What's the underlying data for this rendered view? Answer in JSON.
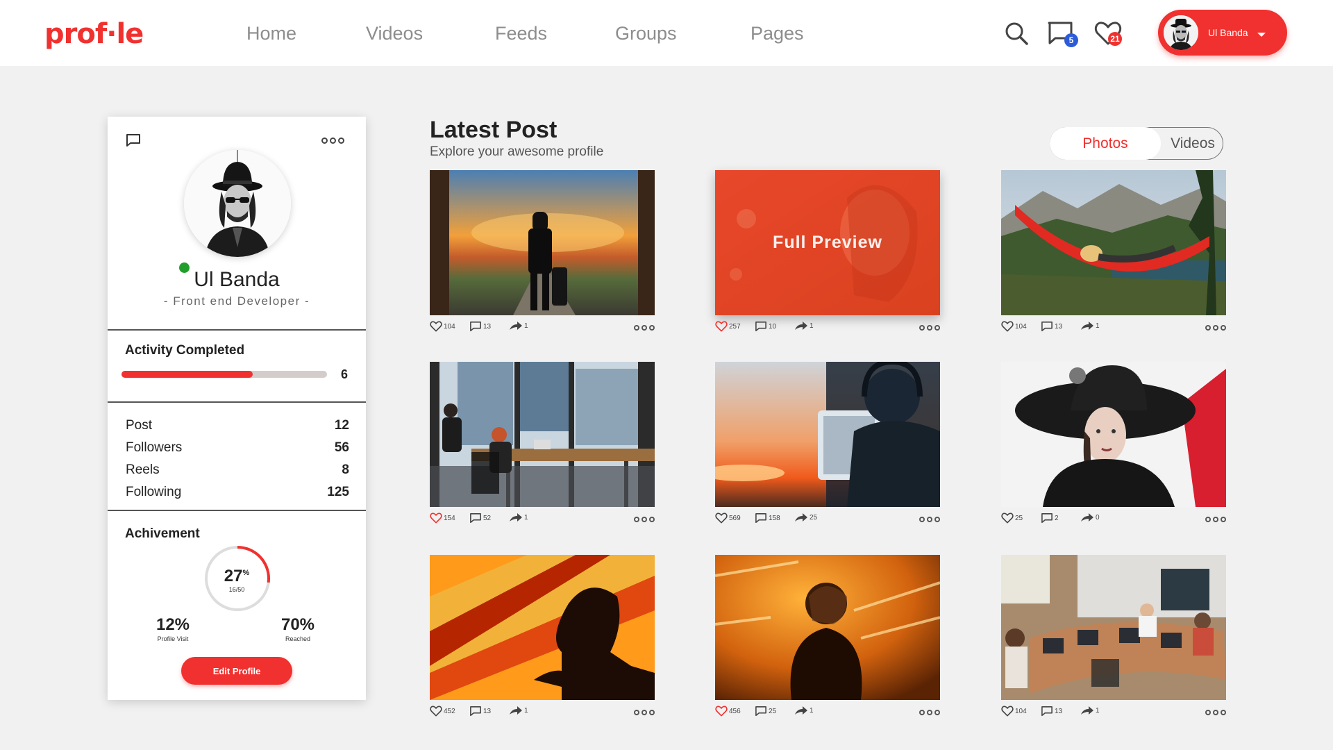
{
  "header": {
    "logo": "prof·le",
    "nav": [
      "Home",
      "Videos",
      "Feeds",
      "Groups",
      "Pages"
    ],
    "messages_badge": "5",
    "likes_badge": "21",
    "user_name": "Ul Banda",
    "accent": "#f0312f"
  },
  "profile": {
    "name": "Ul Banda",
    "role": "- Front end Developer -",
    "status": "online",
    "activity_title": "Activity Completed",
    "activity_value": "6",
    "activity_progress": 0.64,
    "stats": [
      {
        "label": "Post",
        "value": "12"
      },
      {
        "label": "Followers",
        "value": "56"
      },
      {
        "label": "Reels",
        "value": "8"
      },
      {
        "label": "Following",
        "value": "125"
      }
    ],
    "achievement_title": "Achivement",
    "achievement_pct": "27",
    "achievement_pct_symbol": "%",
    "achievement_fraction": "16/50",
    "achievement_progress": 0.27,
    "profile_visit_value": "12%",
    "profile_visit_label": "Profile Visit",
    "reached_value": "70%",
    "reached_label": "Reached",
    "edit_button": "Edit Profile"
  },
  "main": {
    "title": "Latest Post",
    "subtitle": "Explore your awesome profile",
    "toggle": {
      "active": "Photos",
      "inactive": "Videos"
    },
    "full_preview_label": "Full Preview",
    "posts": [
      {
        "likes": "104",
        "comments": "13",
        "shares": "1",
        "liked": false,
        "scene": "traveler-sunset"
      },
      {
        "likes": "257",
        "comments": "10",
        "shares": "1",
        "liked": true,
        "scene": "woman-red-overlay"
      },
      {
        "likes": "104",
        "comments": "13",
        "shares": "1",
        "liked": false,
        "scene": "hammock-mountains"
      },
      {
        "likes": "154",
        "comments": "52",
        "shares": "1",
        "liked": true,
        "scene": "office-window"
      },
      {
        "likes": "569",
        "comments": "158",
        "shares": "25",
        "liked": false,
        "scene": "headphones-sunset"
      },
      {
        "likes": "25",
        "comments": "2",
        "shares": "0",
        "liked": false,
        "scene": "woman-black-hat"
      },
      {
        "likes": "452",
        "comments": "13",
        "shares": "1",
        "liked": false,
        "scene": "silhouette-orange"
      },
      {
        "likes": "456",
        "comments": "25",
        "shares": "1",
        "liked": true,
        "scene": "woman-lights"
      },
      {
        "likes": "104",
        "comments": "13",
        "shares": "1",
        "liked": false,
        "scene": "meeting-room"
      }
    ]
  }
}
